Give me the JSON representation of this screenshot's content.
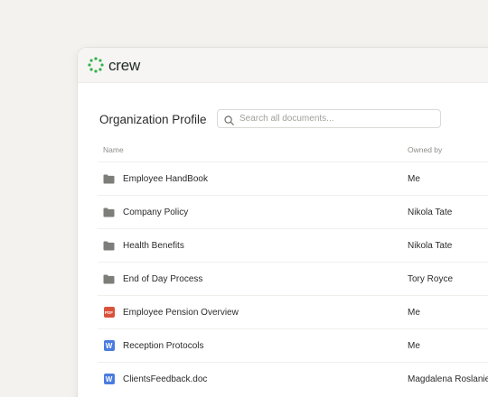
{
  "app": {
    "name": "crew",
    "brand_color": "#2fb24a"
  },
  "page": {
    "title": "Organization Profile"
  },
  "search": {
    "placeholder": "Search all documents..."
  },
  "table": {
    "headers": {
      "name": "Name",
      "owner": "Owned by"
    },
    "rows": [
      {
        "icon": "folder-icon",
        "name": "Employee HandBook",
        "owner": "Me"
      },
      {
        "icon": "folder-icon",
        "name": "Company Policy",
        "owner": "Nikola Tate"
      },
      {
        "icon": "folder-icon",
        "name": "Health Benefits",
        "owner": "Nikola Tate"
      },
      {
        "icon": "folder-icon",
        "name": "End of Day Process",
        "owner": "Tory Royce"
      },
      {
        "icon": "pdf-file-icon",
        "name": "Employee Pension Overview",
        "owner": "Me"
      },
      {
        "icon": "word-file-icon",
        "name": "Reception Protocols",
        "owner": "Me"
      },
      {
        "icon": "word-file-icon",
        "name": "ClientsFeedback.doc",
        "owner": "Magdalena Roslanie"
      }
    ]
  },
  "file_badges": {
    "pdf": "PDF",
    "word": "W"
  }
}
